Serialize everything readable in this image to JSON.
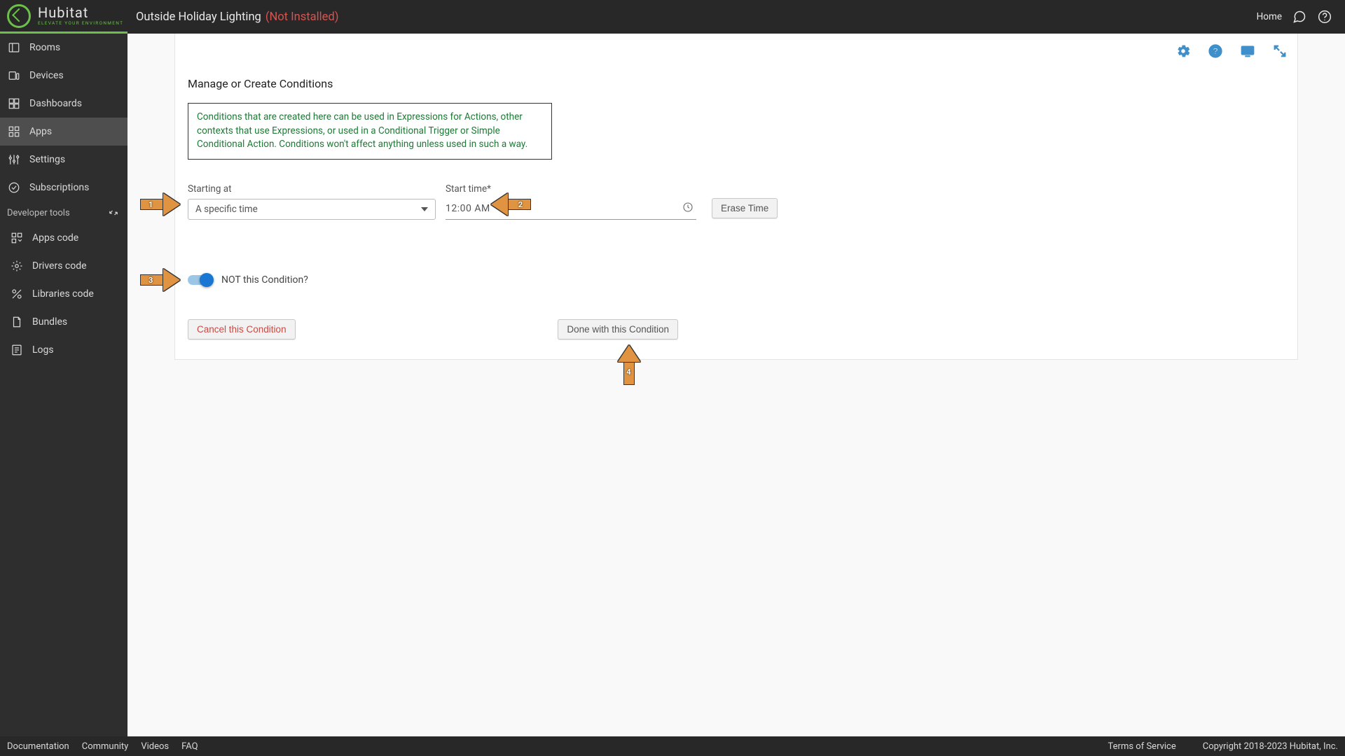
{
  "brand": {
    "name": "Hubitat",
    "tagline": "ELEVATE YOUR ENVIRONMENT"
  },
  "header": {
    "title": "Outside Holiday Lighting",
    "status": "(Not Installed)",
    "home": "Home"
  },
  "sidebar": {
    "items": [
      {
        "label": "Rooms"
      },
      {
        "label": "Devices"
      },
      {
        "label": "Dashboards"
      },
      {
        "label": "Apps"
      },
      {
        "label": "Settings"
      },
      {
        "label": "Subscriptions"
      }
    ],
    "dev_group": "Developer tools",
    "dev_items": [
      {
        "label": "Apps code"
      },
      {
        "label": "Drivers code"
      },
      {
        "label": "Libraries code"
      },
      {
        "label": "Bundles"
      },
      {
        "label": "Logs"
      }
    ]
  },
  "main": {
    "section_title": "Manage or Create Conditions",
    "info_text": "Conditions that are created here can be used in Expressions for Actions, other contexts that use Expressions, or used in a Conditional Trigger or Simple Conditional Action.  Conditions won't affect anything unless used in such a way.",
    "starting_at_label": "Starting at",
    "starting_at_value": "A specific time",
    "start_time_label": "Start time*",
    "start_time_value": "12:00 AM",
    "erase_time": "Erase Time",
    "not_label": "NOT this Condition?",
    "not_state": true,
    "cancel": "Cancel this Condition",
    "done": "Done with this Condition"
  },
  "annotations": {
    "a1": "1",
    "a2": "2",
    "a3": "3",
    "a4": "4"
  },
  "footer": {
    "links": [
      "Documentation",
      "Community",
      "Videos",
      "FAQ"
    ],
    "tos": "Terms of Service",
    "copyright": "Copyright 2018-2023 Hubitat, Inc."
  }
}
